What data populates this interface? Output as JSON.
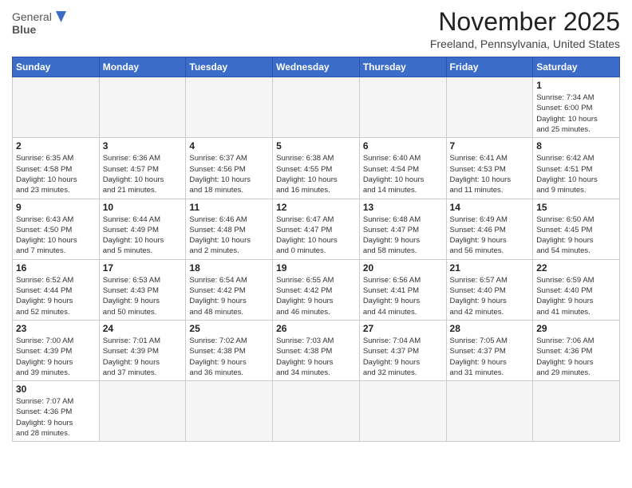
{
  "logo": {
    "line1": "General",
    "line2": "Blue"
  },
  "title": "November 2025",
  "location": "Freeland, Pennsylvania, United States",
  "days_of_week": [
    "Sunday",
    "Monday",
    "Tuesday",
    "Wednesday",
    "Thursday",
    "Friday",
    "Saturday"
  ],
  "weeks": [
    [
      {
        "day": "",
        "info": "",
        "empty": true
      },
      {
        "day": "",
        "info": "",
        "empty": true
      },
      {
        "day": "",
        "info": "",
        "empty": true
      },
      {
        "day": "",
        "info": "",
        "empty": true
      },
      {
        "day": "",
        "info": "",
        "empty": true
      },
      {
        "day": "",
        "info": "",
        "empty": true
      },
      {
        "day": "1",
        "info": "Sunrise: 7:34 AM\nSunset: 6:00 PM\nDaylight: 10 hours\nand 25 minutes.",
        "empty": false
      }
    ],
    [
      {
        "day": "2",
        "info": "Sunrise: 6:35 AM\nSunset: 4:58 PM\nDaylight: 10 hours\nand 23 minutes.",
        "empty": false
      },
      {
        "day": "3",
        "info": "Sunrise: 6:36 AM\nSunset: 4:57 PM\nDaylight: 10 hours\nand 21 minutes.",
        "empty": false
      },
      {
        "day": "4",
        "info": "Sunrise: 6:37 AM\nSunset: 4:56 PM\nDaylight: 10 hours\nand 18 minutes.",
        "empty": false
      },
      {
        "day": "5",
        "info": "Sunrise: 6:38 AM\nSunset: 4:55 PM\nDaylight: 10 hours\nand 16 minutes.",
        "empty": false
      },
      {
        "day": "6",
        "info": "Sunrise: 6:40 AM\nSunset: 4:54 PM\nDaylight: 10 hours\nand 14 minutes.",
        "empty": false
      },
      {
        "day": "7",
        "info": "Sunrise: 6:41 AM\nSunset: 4:53 PM\nDaylight: 10 hours\nand 11 minutes.",
        "empty": false
      },
      {
        "day": "8",
        "info": "Sunrise: 6:42 AM\nSunset: 4:51 PM\nDaylight: 10 hours\nand 9 minutes.",
        "empty": false
      }
    ],
    [
      {
        "day": "9",
        "info": "Sunrise: 6:43 AM\nSunset: 4:50 PM\nDaylight: 10 hours\nand 7 minutes.",
        "empty": false
      },
      {
        "day": "10",
        "info": "Sunrise: 6:44 AM\nSunset: 4:49 PM\nDaylight: 10 hours\nand 5 minutes.",
        "empty": false
      },
      {
        "day": "11",
        "info": "Sunrise: 6:46 AM\nSunset: 4:48 PM\nDaylight: 10 hours\nand 2 minutes.",
        "empty": false
      },
      {
        "day": "12",
        "info": "Sunrise: 6:47 AM\nSunset: 4:47 PM\nDaylight: 10 hours\nand 0 minutes.",
        "empty": false
      },
      {
        "day": "13",
        "info": "Sunrise: 6:48 AM\nSunset: 4:47 PM\nDaylight: 9 hours\nand 58 minutes.",
        "empty": false
      },
      {
        "day": "14",
        "info": "Sunrise: 6:49 AM\nSunset: 4:46 PM\nDaylight: 9 hours\nand 56 minutes.",
        "empty": false
      },
      {
        "day": "15",
        "info": "Sunrise: 6:50 AM\nSunset: 4:45 PM\nDaylight: 9 hours\nand 54 minutes.",
        "empty": false
      }
    ],
    [
      {
        "day": "16",
        "info": "Sunrise: 6:52 AM\nSunset: 4:44 PM\nDaylight: 9 hours\nand 52 minutes.",
        "empty": false
      },
      {
        "day": "17",
        "info": "Sunrise: 6:53 AM\nSunset: 4:43 PM\nDaylight: 9 hours\nand 50 minutes.",
        "empty": false
      },
      {
        "day": "18",
        "info": "Sunrise: 6:54 AM\nSunset: 4:42 PM\nDaylight: 9 hours\nand 48 minutes.",
        "empty": false
      },
      {
        "day": "19",
        "info": "Sunrise: 6:55 AM\nSunset: 4:42 PM\nDaylight: 9 hours\nand 46 minutes.",
        "empty": false
      },
      {
        "day": "20",
        "info": "Sunrise: 6:56 AM\nSunset: 4:41 PM\nDaylight: 9 hours\nand 44 minutes.",
        "empty": false
      },
      {
        "day": "21",
        "info": "Sunrise: 6:57 AM\nSunset: 4:40 PM\nDaylight: 9 hours\nand 42 minutes.",
        "empty": false
      },
      {
        "day": "22",
        "info": "Sunrise: 6:59 AM\nSunset: 4:40 PM\nDaylight: 9 hours\nand 41 minutes.",
        "empty": false
      }
    ],
    [
      {
        "day": "23",
        "info": "Sunrise: 7:00 AM\nSunset: 4:39 PM\nDaylight: 9 hours\nand 39 minutes.",
        "empty": false
      },
      {
        "day": "24",
        "info": "Sunrise: 7:01 AM\nSunset: 4:39 PM\nDaylight: 9 hours\nand 37 minutes.",
        "empty": false
      },
      {
        "day": "25",
        "info": "Sunrise: 7:02 AM\nSunset: 4:38 PM\nDaylight: 9 hours\nand 36 minutes.",
        "empty": false
      },
      {
        "day": "26",
        "info": "Sunrise: 7:03 AM\nSunset: 4:38 PM\nDaylight: 9 hours\nand 34 minutes.",
        "empty": false
      },
      {
        "day": "27",
        "info": "Sunrise: 7:04 AM\nSunset: 4:37 PM\nDaylight: 9 hours\nand 32 minutes.",
        "empty": false
      },
      {
        "day": "28",
        "info": "Sunrise: 7:05 AM\nSunset: 4:37 PM\nDaylight: 9 hours\nand 31 minutes.",
        "empty": false
      },
      {
        "day": "29",
        "info": "Sunrise: 7:06 AM\nSunset: 4:36 PM\nDaylight: 9 hours\nand 29 minutes.",
        "empty": false
      }
    ],
    [
      {
        "day": "30",
        "info": "Sunrise: 7:07 AM\nSunset: 4:36 PM\nDaylight: 9 hours\nand 28 minutes.",
        "empty": false
      },
      {
        "day": "",
        "info": "",
        "empty": true
      },
      {
        "day": "",
        "info": "",
        "empty": true
      },
      {
        "day": "",
        "info": "",
        "empty": true
      },
      {
        "day": "",
        "info": "",
        "empty": true
      },
      {
        "day": "",
        "info": "",
        "empty": true
      },
      {
        "day": "",
        "info": "",
        "empty": true
      }
    ]
  ]
}
